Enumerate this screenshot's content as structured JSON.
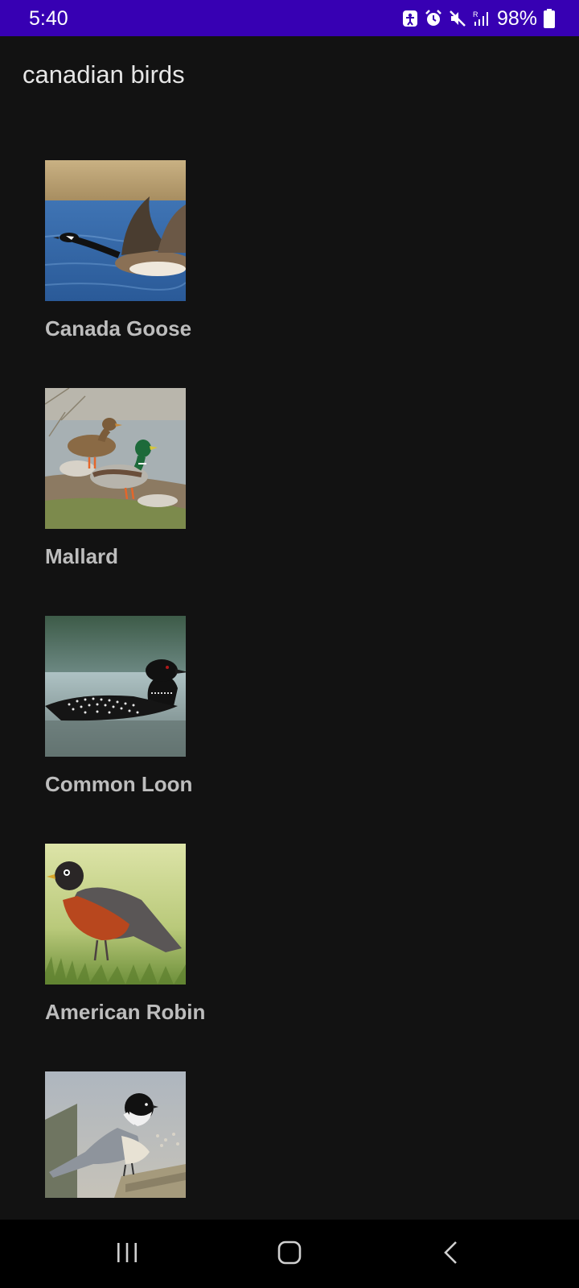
{
  "status_bar": {
    "time": "5:40",
    "battery": "98%",
    "icons": [
      "accessibility-icon",
      "alarm-icon",
      "mute-icon",
      "signal-icon",
      "battery-icon"
    ]
  },
  "app_bar": {
    "title": "canadian birds"
  },
  "birds": [
    {
      "name": "Canada Goose",
      "image": "canada-goose-photo"
    },
    {
      "name": "Mallard",
      "image": "mallard-photo"
    },
    {
      "name": "Common Loon",
      "image": "common-loon-photo"
    },
    {
      "name": "American Robin",
      "image": "american-robin-photo"
    },
    {
      "name": "",
      "image": "chickadee-photo"
    }
  ],
  "nav_bar": {
    "buttons": [
      "recents-icon",
      "home-icon",
      "back-icon"
    ]
  },
  "colors": {
    "status_bar": "#3700B3",
    "background": "#121212",
    "nav_bar": "#000000",
    "title_text": "#e6e6e6",
    "item_text": "#bdbdbd"
  }
}
